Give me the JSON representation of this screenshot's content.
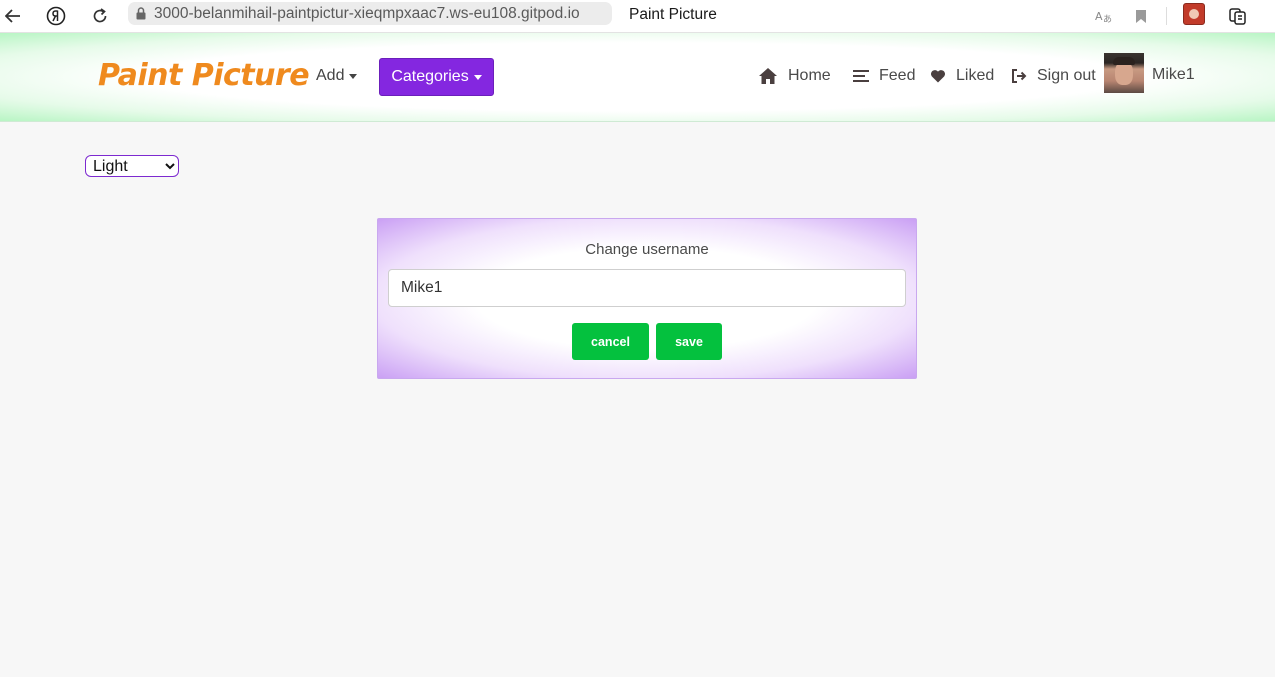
{
  "browser": {
    "url": "3000-belanmihail-paintpictur-xieqmpxaac7.ws-eu108.gitpod.io",
    "tab_title": "Paint Picture",
    "icons": [
      "back-arrow-icon",
      "yandex-icon",
      "reload-icon",
      "lock-icon",
      "translate-icon",
      "bookmark-icon",
      "extension-icon",
      "collections-icon"
    ]
  },
  "navbar": {
    "brand": "Paint Picture",
    "add_label": "Add",
    "categories_label": "Categories",
    "links": {
      "home": "Home",
      "feed": "Feed",
      "liked": "Liked",
      "sign_out": "Sign out"
    },
    "username": "Mike1",
    "colors": {
      "brand": "#ef8a1e",
      "categories_bg": "#8427e0"
    }
  },
  "theme": {
    "selected": "Light"
  },
  "card": {
    "title": "Change username",
    "input_value": "Mike1",
    "cancel_label": "cancel",
    "save_label": "save",
    "button_color": "#04c13e"
  }
}
